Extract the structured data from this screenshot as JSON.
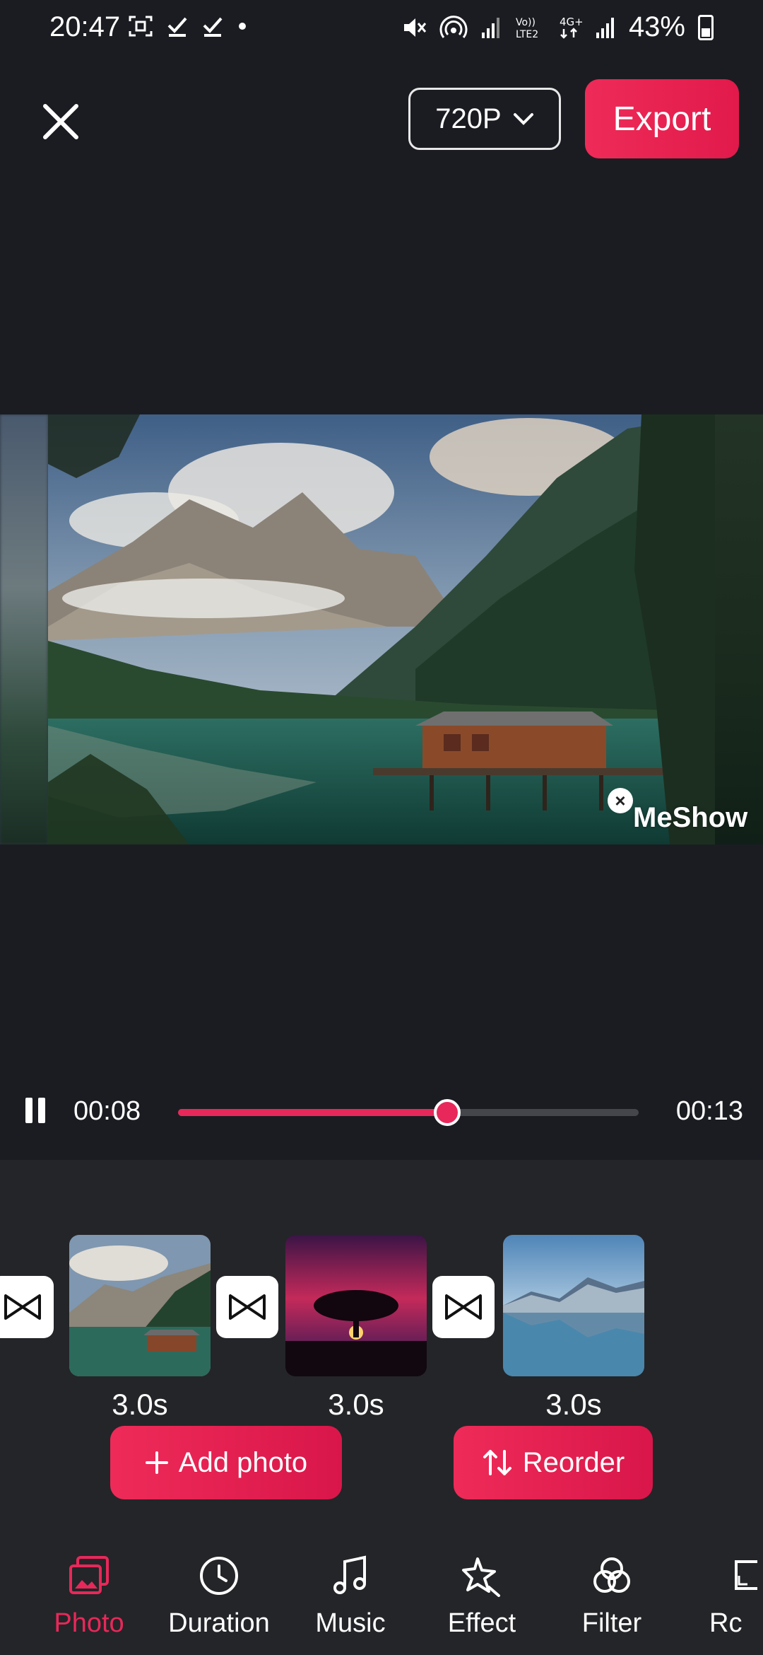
{
  "status_bar": {
    "time": "20:47",
    "battery": "43%",
    "left_icons": [
      "screenshot-icon",
      "check-icon",
      "check-icon",
      "dot-icon"
    ],
    "right_icons": [
      "mute-icon",
      "hotspot-icon",
      "signal-icon",
      "volte-icon",
      "4g-icon",
      "signal-icon",
      "battery-icon"
    ]
  },
  "topbar": {
    "resolution": "720P",
    "export_label": "Export"
  },
  "preview": {
    "watermark": "MeShow"
  },
  "player": {
    "current_time": "00:08",
    "total_time": "00:13",
    "progress": 0.585
  },
  "clips": [
    {
      "duration": "3.0s",
      "image": "mountain lake with boathouse"
    },
    {
      "duration": "3.0s",
      "image": "tree silhouette at sunset"
    },
    {
      "duration": "3.0s",
      "image": "mountain reflection lake"
    }
  ],
  "actions": {
    "add_photo": "Add photo",
    "reorder": "Reorder"
  },
  "tabs": [
    {
      "label": "Photo",
      "icon": "photo-icon",
      "active": true
    },
    {
      "label": "Duration",
      "icon": "clock-icon",
      "active": false
    },
    {
      "label": "Music",
      "icon": "music-icon",
      "active": false
    },
    {
      "label": "Effect",
      "icon": "sparkle-icon",
      "active": false
    },
    {
      "label": "Filter",
      "icon": "filter-icon",
      "active": false
    },
    {
      "label": "Rc",
      "icon": "ratio-icon",
      "active": false
    }
  ],
  "colors": {
    "accent": "#e8285a",
    "background": "#1b1c21",
    "panel": "#242528"
  }
}
